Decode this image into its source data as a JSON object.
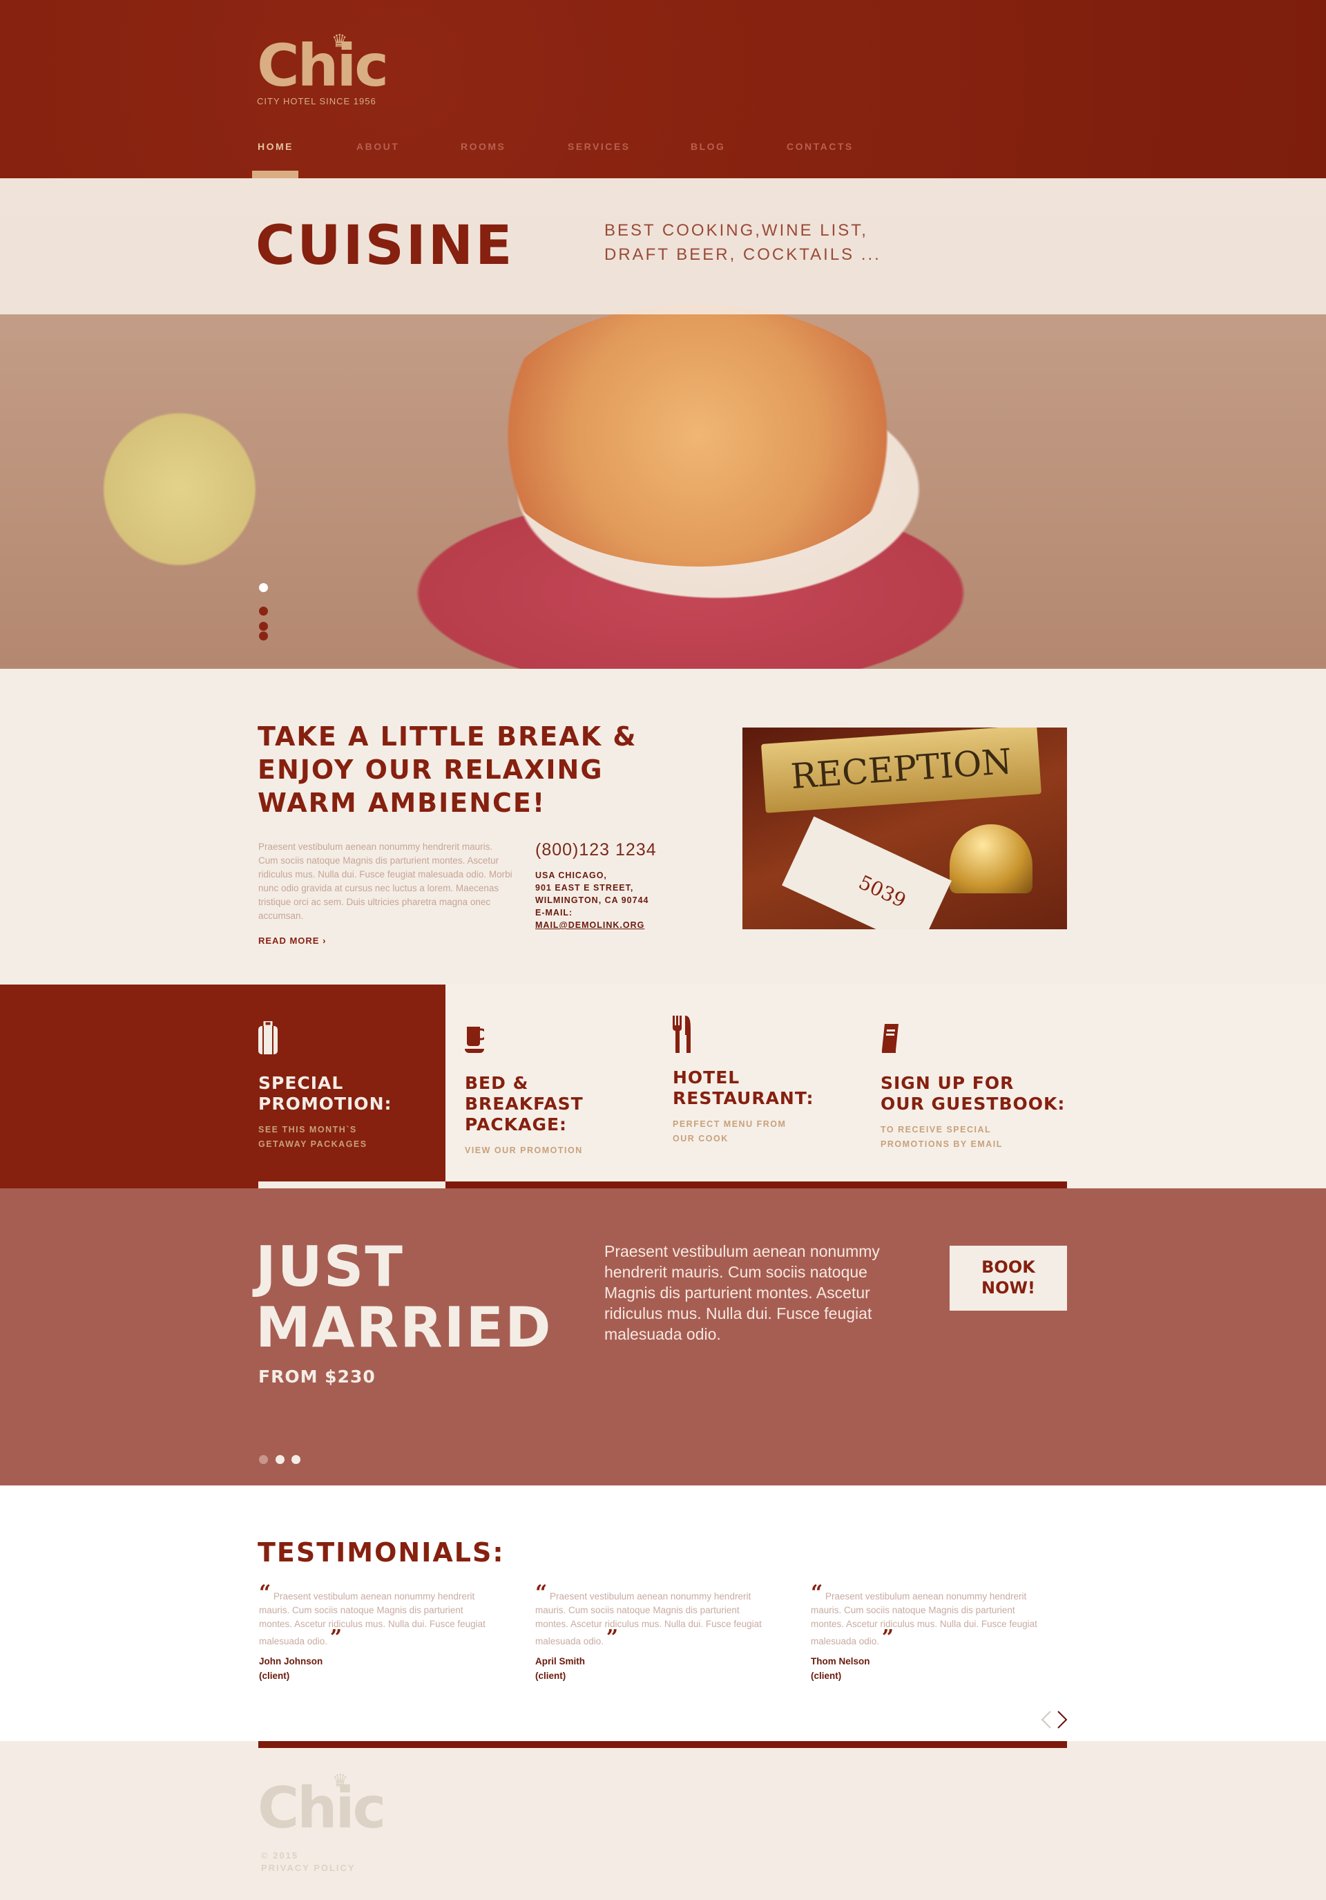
{
  "brand": {
    "logo": "Chic",
    "tagline": "CITY HOTEL SINCE 1956"
  },
  "nav": [
    {
      "label": "HOME",
      "active": true
    },
    {
      "label": "ABOUT"
    },
    {
      "label": "ROOMS"
    },
    {
      "label": "SERVICES"
    },
    {
      "label": "BLOG"
    },
    {
      "label": "CONTACTS"
    }
  ],
  "hero": {
    "title": "CUISINE",
    "subtitle_1": "BEST COOKING,WINE LIST,",
    "subtitle_2": "DRAFT BEER, COCKTAILS ...",
    "slides": 4,
    "active_slide": 1
  },
  "about": {
    "heading_1": "TAKE A LITTLE BREAK &",
    "heading_2": "ENJOY OUR RELAXING",
    "heading_3": "WARM AMBIENCE!",
    "text": "Praesent vestibulum aenean nonummy hendrerit mauris. Cum sociis natoque Magnis dis parturient montes. Ascetur ridiculus mus. Nulla dui. Fusce feugiat malesuada odio. Morbi nunc odio gravida at cursus nec luctus a lorem. Maecenas tristique orci ac sem. Duis ultricies pharetra magna onec accumsan.",
    "read_more": "READ MORE",
    "phone": "(800)123 1234",
    "address_1": "USA  CHICAGO,",
    "address_2": "901 EAST E STREET,",
    "address_3": "WILMINGTON, CA 90744",
    "email_label": "E-MAIL:",
    "email": "MAIL@DEMOLINK.ORG",
    "image_sign": "RECEPTION",
    "image_card": "5039"
  },
  "features": [
    {
      "icon": "suitcase-icon",
      "title_1": "SPECIAL",
      "title_2": "PROMOTION:",
      "title_3": "",
      "sub_1": "SEE THIS MONTH`S",
      "sub_2": "GETAWAY PACKAGES"
    },
    {
      "icon": "coffee-cup-icon",
      "title_1": "BED &",
      "title_2": "BREAKFAST",
      "title_3": "PACKAGE:",
      "sub_1": "VIEW OUR PROMOTION",
      "sub_2": ""
    },
    {
      "icon": "fork-knife-icon",
      "title_1": "HOTEL",
      "title_2": "RESTAURANT:",
      "title_3": "",
      "sub_1": "PERFECT MENU FROM",
      "sub_2": "OUR COOK"
    },
    {
      "icon": "book-icon",
      "title_1": "SIGN UP FOR",
      "title_2": "OUR GUESTBOOK:",
      "title_3": "",
      "sub_1": "TO RECEIVE SPECIAL",
      "sub_2": "PROMOTIONS BY EMAIL"
    }
  ],
  "promo": {
    "title_1": "JUST",
    "title_2": "MARRIED",
    "price": "FROM $230",
    "text": "Praesent vestibulum aenean nonummy hendrerit mauris. Cum sociis natoque Magnis dis parturient montes. Ascetur ridiculus mus. Nulla dui. Fusce feugiat malesuada odio.",
    "button": "BOOK NOW!",
    "slides": 3,
    "active_slide": 1
  },
  "testimonials": {
    "title": "TESTIMONIALS:",
    "items": [
      {
        "text": "Praesent vestibulum aenean nonummy hendrerit mauris. Cum sociis natoque Magnis dis parturient montes. Ascetur ridiculus mus. Nulla dui. Fusce feugiat malesuada odio.",
        "name": "John Johnson",
        "role": "(client)"
      },
      {
        "text": "Praesent vestibulum aenean nonummy hendrerit mauris. Cum sociis natoque Magnis dis parturient montes. Ascetur ridiculus mus. Nulla dui. Fusce feugiat malesuada odio.",
        "name": "April Smith",
        "role": "(client)"
      },
      {
        "text": "Praesent vestibulum aenean nonummy hendrerit mauris. Cum sociis natoque Magnis dis parturient montes. Ascetur ridiculus mus. Nulla dui. Fusce feugiat malesuada odio.",
        "name": "Thom Nelson",
        "role": "(client)"
      }
    ]
  },
  "footer": {
    "logo": "Chic",
    "copyright": "© 2015",
    "privacy": "PRIVACY POLICY"
  },
  "colors": {
    "primary": "#86200f",
    "accent": "#d9ae82",
    "cream": "#f4ede6",
    "promo": "#a75e52"
  }
}
